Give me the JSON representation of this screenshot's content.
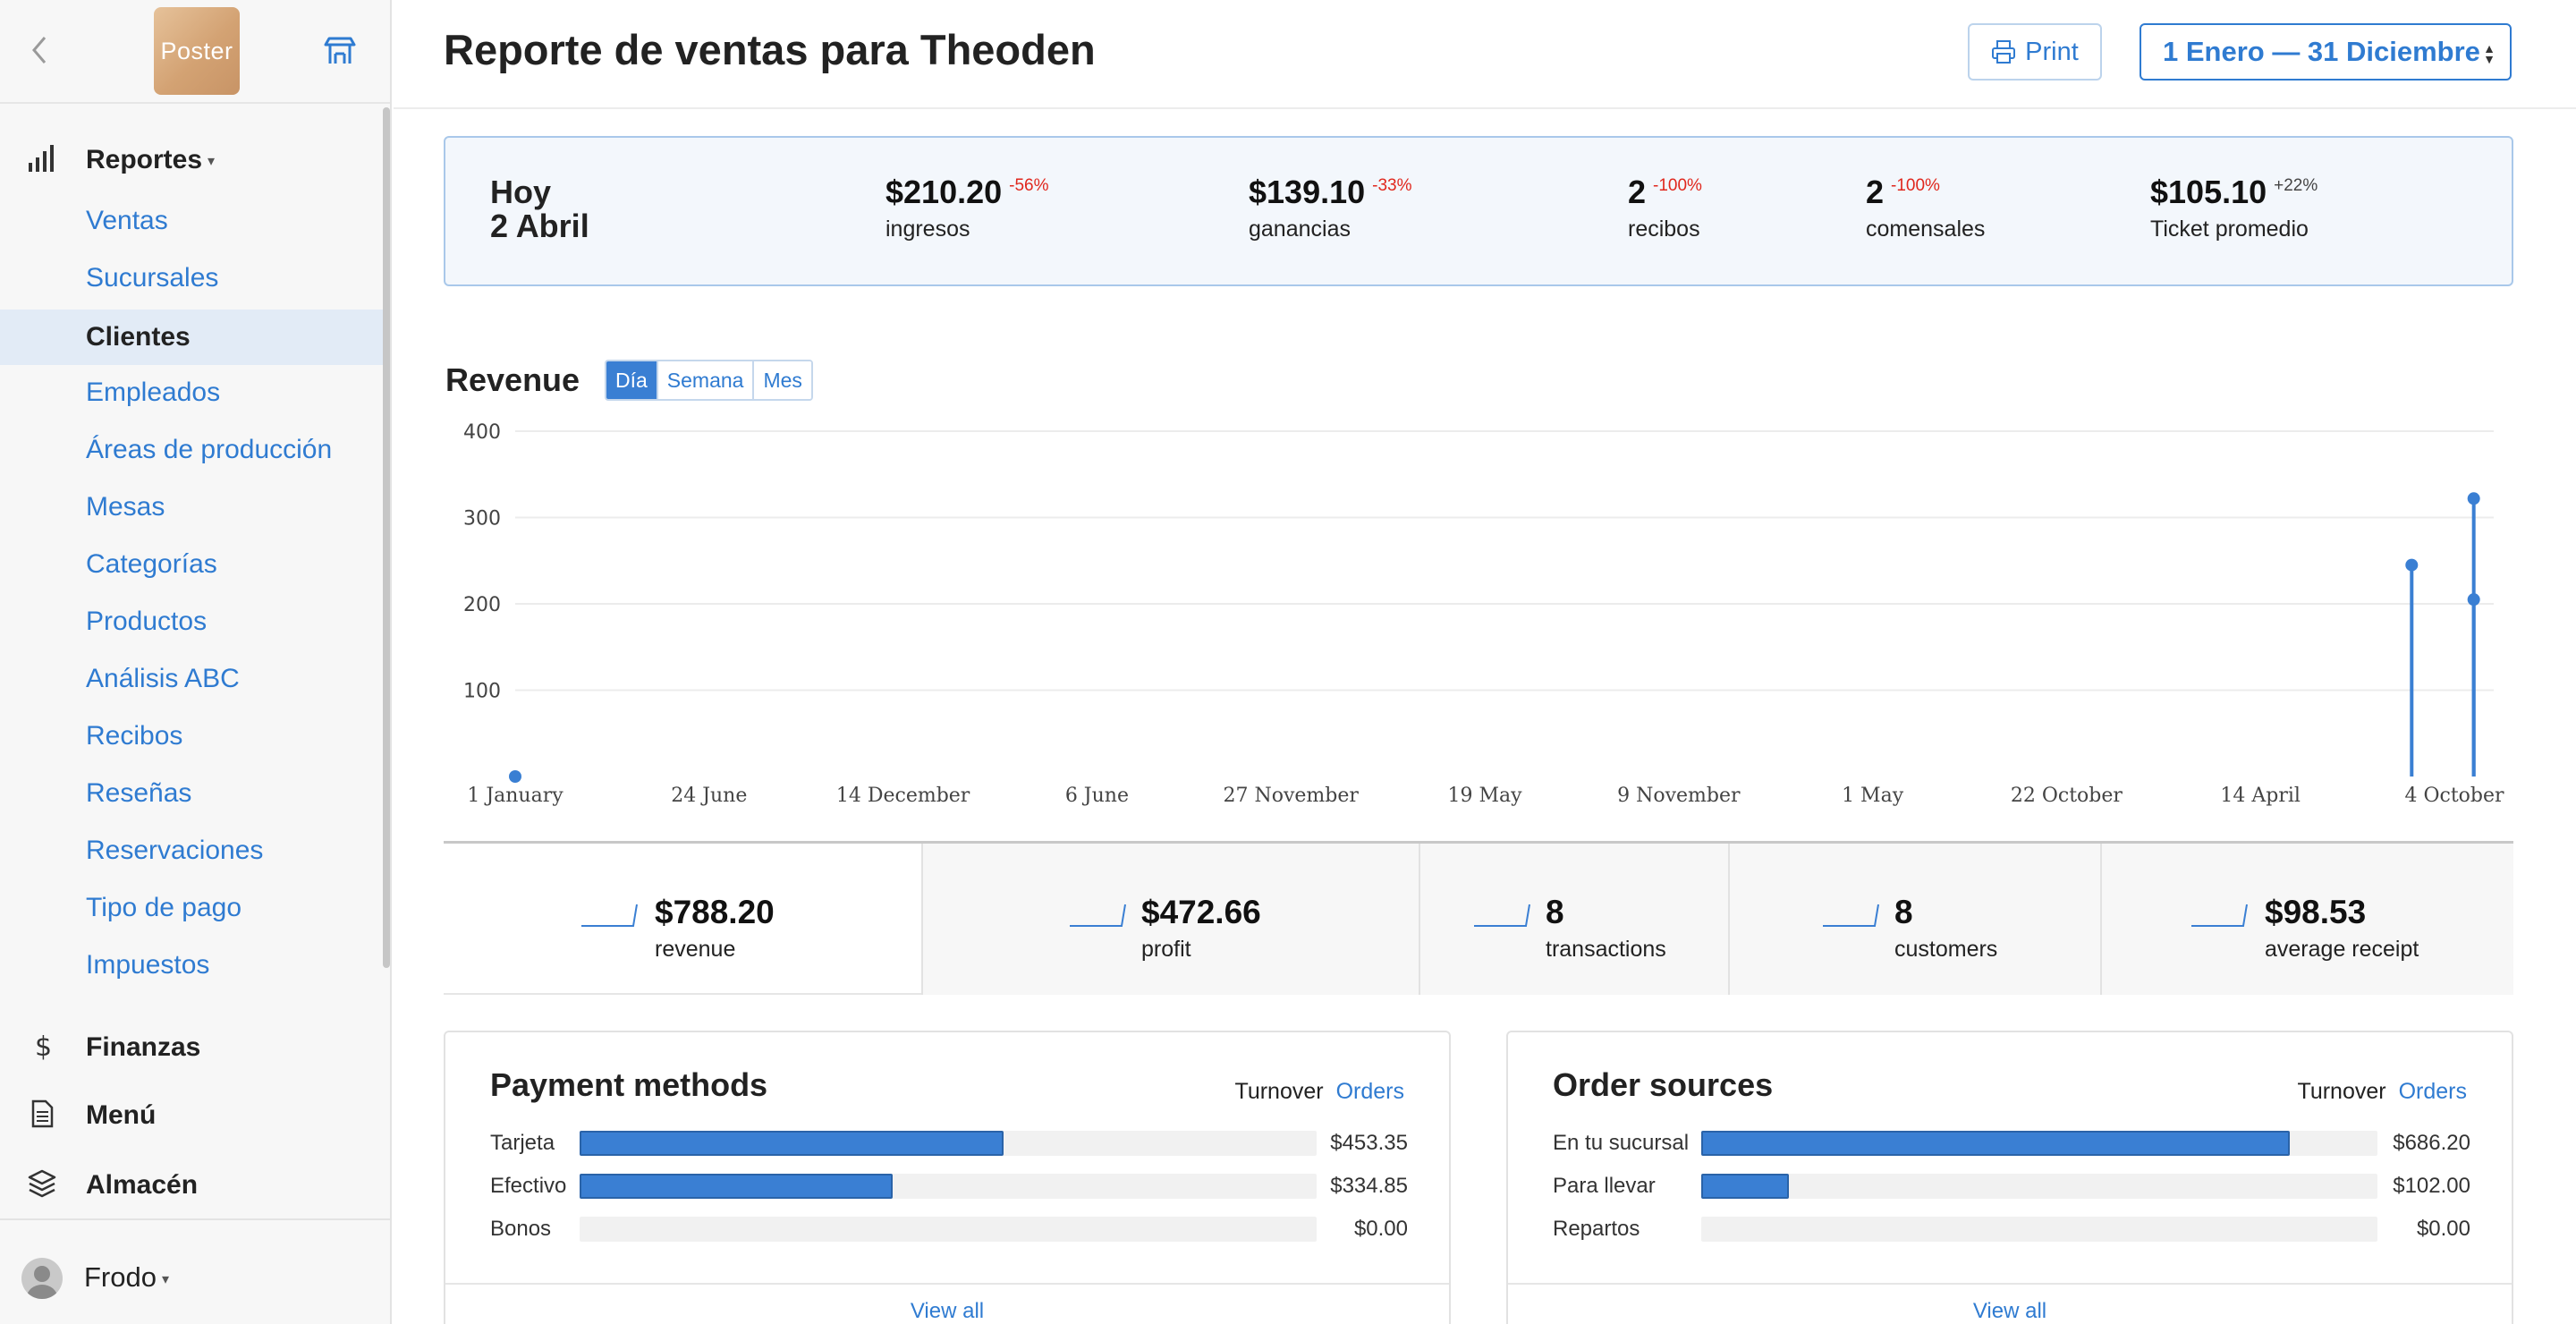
{
  "sidebar": {
    "logo_text": "Poster",
    "section_reports": "Reportes",
    "items": [
      {
        "label": "Ventas"
      },
      {
        "label": "Sucursales"
      },
      {
        "label": "Clientes"
      },
      {
        "label": "Empleados"
      },
      {
        "label": "Áreas de producción"
      },
      {
        "label": "Mesas"
      },
      {
        "label": "Categorías"
      },
      {
        "label": "Productos"
      },
      {
        "label": "Análisis ABC"
      },
      {
        "label": "Recibos"
      },
      {
        "label": "Reseñas"
      },
      {
        "label": "Reservaciones"
      },
      {
        "label": "Tipo de pago"
      },
      {
        "label": "Impuestos"
      }
    ],
    "active_item": "Clientes",
    "sections": [
      {
        "label": "Finanzas",
        "icon": "dollar-icon"
      },
      {
        "label": "Menú",
        "icon": "document-icon"
      },
      {
        "label": "Almacén",
        "icon": "layers-icon"
      }
    ],
    "user": "Frodo"
  },
  "header": {
    "title": "Reporte de ventas para Theoden",
    "print_label": "Print",
    "date_range": "1 Enero — 31 Diciembre"
  },
  "today": {
    "day": "Hoy",
    "date": "2 Abril",
    "kpis": [
      {
        "value": "$210.20",
        "change": "-56%",
        "label": "ingresos"
      },
      {
        "value": "$139.10",
        "change": "-33%",
        "label": "ganancias"
      },
      {
        "value": "2",
        "change": "-100%",
        "label": "recibos"
      },
      {
        "value": "2",
        "change": "-100%",
        "label": "comensales"
      },
      {
        "value": "$105.10",
        "change": "+22%",
        "label": "Ticket promedio"
      }
    ]
  },
  "revenue": {
    "title": "Revenue",
    "periods": [
      "Día",
      "Semana",
      "Mes"
    ],
    "active_period": "Día"
  },
  "chart_data": {
    "type": "line",
    "x_ticks": [
      "1 January",
      "24 June",
      "14 December",
      "6 June",
      "27 November",
      "19 May",
      "9 November",
      "1 May",
      "22 October",
      "14 April",
      "4 October"
    ],
    "y_ticks": [
      100,
      200,
      300,
      400
    ],
    "ylim": [
      0,
      400
    ],
    "grid": true,
    "series": [
      {
        "values": [
          {
            "x_index": 0,
            "y": 0
          },
          {
            "x_index": 9.78,
            "y": 245
          },
          {
            "x_index": 10.1,
            "y": 205
          },
          {
            "x_index": 10.1,
            "y": 322
          }
        ]
      }
    ],
    "color": "#3a7fd3"
  },
  "totals": [
    {
      "value": "$788.20",
      "label": "revenue"
    },
    {
      "value": "$472.66",
      "label": "profit"
    },
    {
      "value": "8",
      "label": "transactions"
    },
    {
      "value": "8",
      "label": "customers"
    },
    {
      "value": "$98.53",
      "label": "average receipt"
    }
  ],
  "payment_methods": {
    "title": "Payment methods",
    "tab_turnover": "Turnover",
    "tab_orders": "Orders",
    "rows": [
      {
        "label": "Tarjeta",
        "value": "$453.35",
        "fraction": 0.575
      },
      {
        "label": "Efectivo",
        "value": "$334.85",
        "fraction": 0.425
      },
      {
        "label": "Bonos",
        "value": "$0.00",
        "fraction": 0
      }
    ],
    "view_all": "View all"
  },
  "order_sources": {
    "title": "Order sources",
    "tab_turnover": "Turnover",
    "tab_orders": "Orders",
    "rows": [
      {
        "label": "En tu sucursal",
        "value": "$686.20",
        "fraction": 0.87
      },
      {
        "label": "Para llevar",
        "value": "$102.00",
        "fraction": 0.13
      },
      {
        "label": "Repartos",
        "value": "$0.00",
        "fraction": 0
      }
    ],
    "view_all": "View all"
  }
}
